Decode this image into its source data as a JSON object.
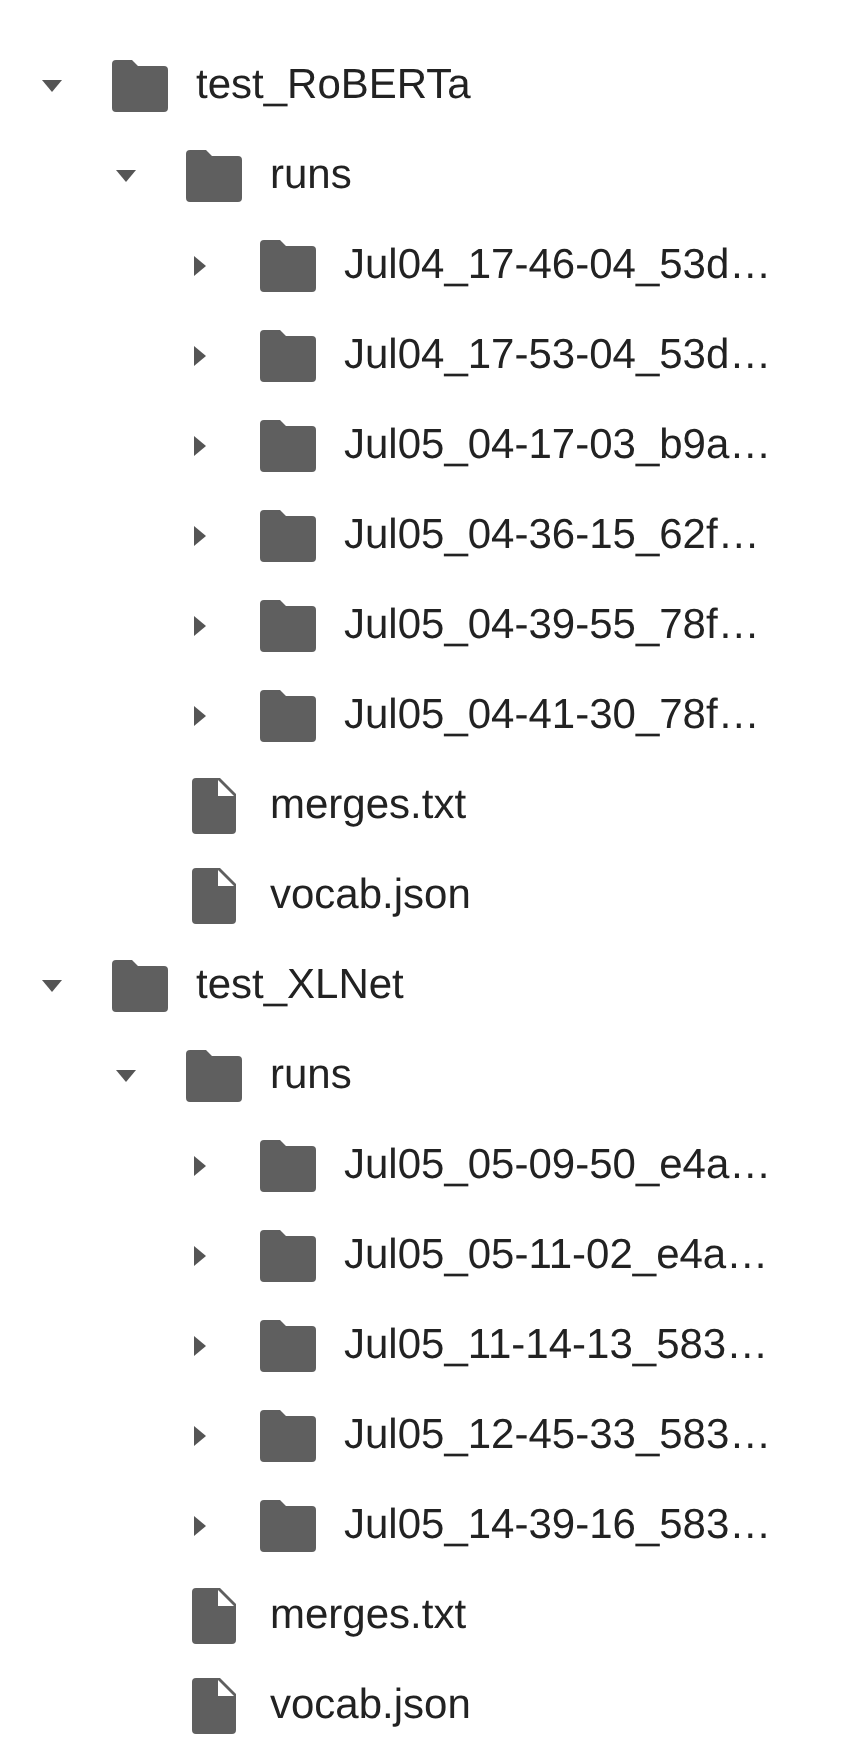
{
  "tree": [
    {
      "kind": "folder",
      "name": "test_RoBERTa",
      "expanded": true,
      "children": [
        {
          "kind": "folder",
          "name": "runs",
          "expanded": true,
          "children": [
            {
              "kind": "folder",
              "name": "Jul04_17-46-04_53d…",
              "expanded": false
            },
            {
              "kind": "folder",
              "name": "Jul04_17-53-04_53d…",
              "expanded": false
            },
            {
              "kind": "folder",
              "name": "Jul05_04-17-03_b9a…",
              "expanded": false
            },
            {
              "kind": "folder",
              "name": "Jul05_04-36-15_62f…",
              "expanded": false
            },
            {
              "kind": "folder",
              "name": "Jul05_04-39-55_78f…",
              "expanded": false
            },
            {
              "kind": "folder",
              "name": "Jul05_04-41-30_78f…",
              "expanded": false
            }
          ]
        },
        {
          "kind": "file",
          "name": "merges.txt"
        },
        {
          "kind": "file",
          "name": "vocab.json"
        }
      ]
    },
    {
      "kind": "folder",
      "name": "test_XLNet",
      "expanded": true,
      "children": [
        {
          "kind": "folder",
          "name": "runs",
          "expanded": true,
          "children": [
            {
              "kind": "folder",
              "name": "Jul05_05-09-50_e4a…",
              "expanded": false
            },
            {
              "kind": "folder",
              "name": "Jul05_05-11-02_e4a…",
              "expanded": false
            },
            {
              "kind": "folder",
              "name": "Jul05_11-14-13_583…",
              "expanded": false
            },
            {
              "kind": "folder",
              "name": "Jul05_12-45-33_583…",
              "expanded": false
            },
            {
              "kind": "folder",
              "name": "Jul05_14-39-16_583…",
              "expanded": false
            }
          ]
        },
        {
          "kind": "file",
          "name": "merges.txt"
        },
        {
          "kind": "file",
          "name": "vocab.json"
        }
      ]
    }
  ]
}
